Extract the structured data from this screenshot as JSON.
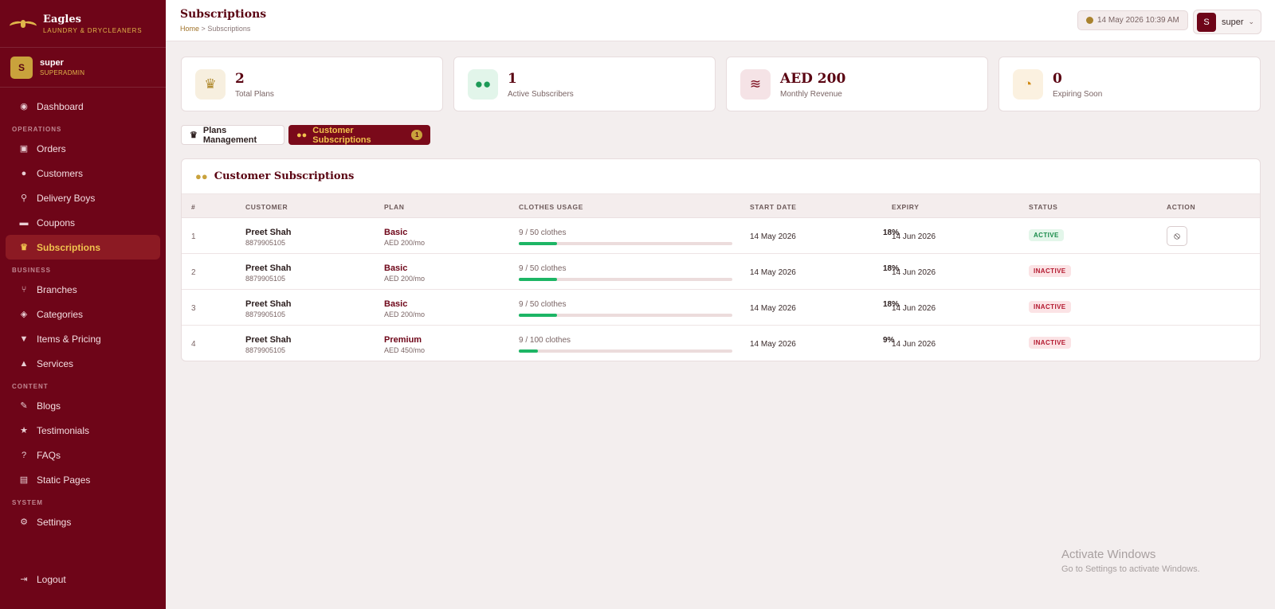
{
  "brand": {
    "name": "Eagles",
    "tagline": "LAUNDRY & DRYCLEANERS"
  },
  "user": {
    "initial": "S",
    "name": "super",
    "role": "SUPERADMIN"
  },
  "nav": {
    "dashboard": "Dashboard",
    "sections": {
      "operations": "OPERATIONS",
      "business": "BUSINESS",
      "content": "CONTENT",
      "system": "SYSTEM"
    },
    "orders": "Orders",
    "customers": "Customers",
    "delivery_boys": "Delivery Boys",
    "coupons": "Coupons",
    "subscriptions": "Subscriptions",
    "branches": "Branches",
    "categories": "Categories",
    "items_pricing": "Items & Pricing",
    "services": "Services",
    "blogs": "Blogs",
    "testimonials": "Testimonials",
    "faqs": "FAQs",
    "static_pages": "Static Pages",
    "settings": "Settings",
    "logout": "Logout"
  },
  "header": {
    "title": "Subscriptions",
    "breadcrumb_home": "Home",
    "breadcrumb_sep": ">",
    "breadcrumb_current": "Subscriptions",
    "datetime": "14 May 2026 10:39 AM",
    "user_initial": "S",
    "user_name": "super"
  },
  "stats": [
    {
      "value": "2",
      "label": "Total Plans"
    },
    {
      "value": "1",
      "label": "Active Subscribers"
    },
    {
      "value": "AED 200",
      "label": "Monthly Revenue"
    },
    {
      "value": "0",
      "label": "Expiring Soon"
    }
  ],
  "tabs": {
    "plans": "Plans Management",
    "customers": "Customer Subscriptions",
    "customers_count": "1"
  },
  "table": {
    "title": "Customer Subscriptions",
    "headers": [
      "#",
      "CUSTOMER",
      "PLAN",
      "CLOTHES USAGE",
      "START DATE",
      "EXPIRY",
      "STATUS",
      "ACTION"
    ],
    "rows": [
      {
        "idx": "1",
        "name": "Preet Shah",
        "phone": "8879905105",
        "plan": "Basic",
        "price": "AED 200/mo",
        "usage": "9 / 50 clothes",
        "pct": "18%",
        "progress": 0.18,
        "start": "14 May 2026",
        "expiry": "14 Jun 2026",
        "status": "ACTIVE"
      },
      {
        "idx": "2",
        "name": "Preet Shah",
        "phone": "8879905105",
        "plan": "Basic",
        "price": "AED 200/mo",
        "usage": "9 / 50 clothes",
        "pct": "18%",
        "progress": 0.18,
        "start": "14 May 2026",
        "expiry": "14 Jun 2026",
        "status": "INACTIVE"
      },
      {
        "idx": "3",
        "name": "Preet Shah",
        "phone": "8879905105",
        "plan": "Basic",
        "price": "AED 200/mo",
        "usage": "9 / 50 clothes",
        "pct": "18%",
        "progress": 0.18,
        "start": "14 May 2026",
        "expiry": "14 Jun 2026",
        "status": "INACTIVE"
      },
      {
        "idx": "4",
        "name": "Preet Shah",
        "phone": "8879905105",
        "plan": "Premium",
        "price": "AED 450/mo",
        "usage": "9 / 100 clothes",
        "pct": "9%",
        "progress": 0.09,
        "start": "14 May 2026",
        "expiry": "14 Jun 2026",
        "status": "INACTIVE"
      }
    ]
  },
  "watermark": {
    "line1": "Activate Windows",
    "line2": "Go to Settings to activate Windows."
  },
  "colors": {
    "sidebar": "#6e0518",
    "accent_gold": "#c9a23c",
    "progress": "#1db565"
  }
}
